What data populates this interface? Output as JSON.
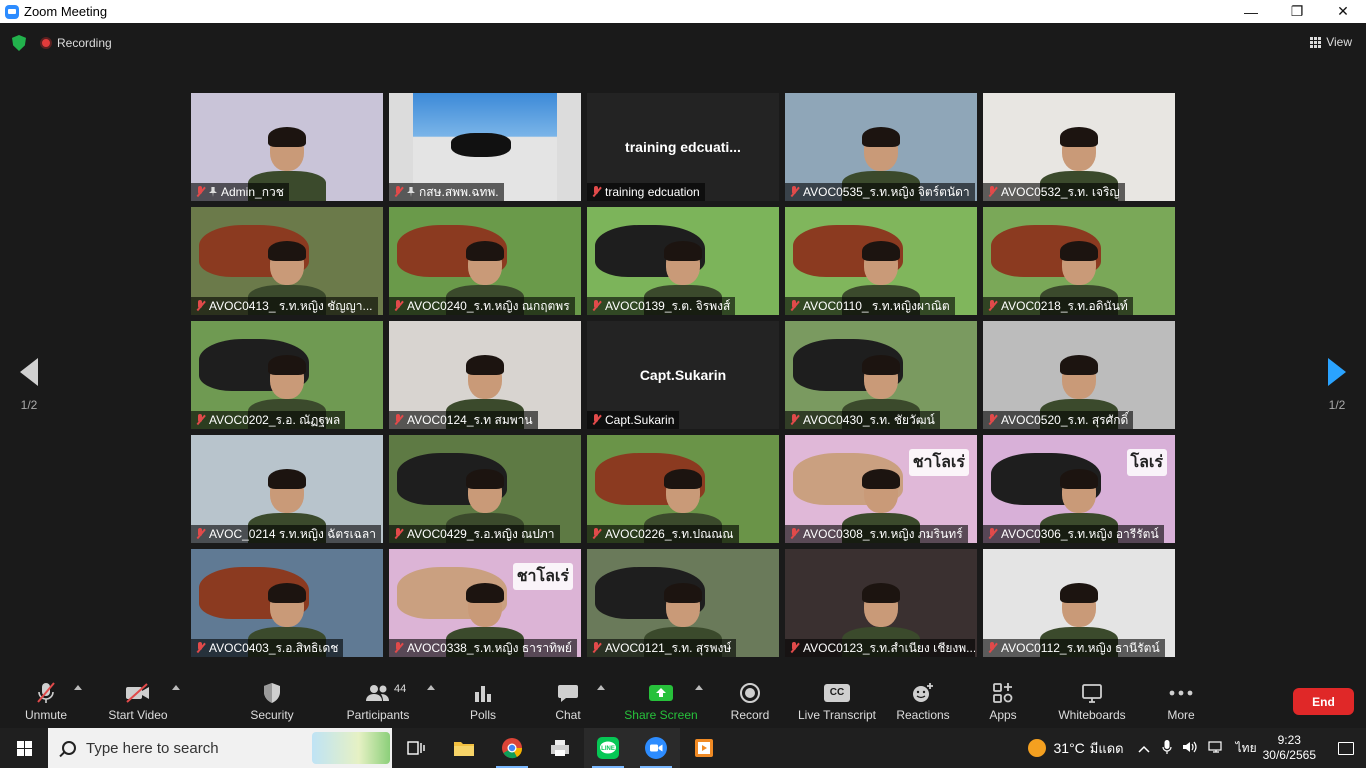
{
  "window": {
    "title": "Zoom Meeting",
    "minimize": "—",
    "restore": "❐",
    "close": "✕"
  },
  "meeting": {
    "recording_label": "Recording",
    "view_label": "View",
    "page_indicator_left": "1/2",
    "page_indicator_right": "1/2"
  },
  "participants": [
    {
      "name": "Admin_กวช",
      "bg": "#c9c4d8",
      "type": "admin"
    },
    {
      "name": "กสษ.สพพ.ฉทพ.",
      "bg": "#dcdcdc",
      "type": "photo"
    },
    {
      "name": "training edcuation",
      "bg": "#232323",
      "type": "nameonly",
      "display": "training  edcuati..."
    },
    {
      "name": "AVOC0535_ร.ท.หญิง จิตร์ตนัดา",
      "bg": "#8fa6b8",
      "type": "person"
    },
    {
      "name": "AVOC0532_ร.ท. เจริญ",
      "bg": "#e8e6e2",
      "type": "person"
    },
    {
      "name": "AVOC0413_ ร.ท.หญิง ชัญญา...",
      "bg": "#6b7a4a",
      "type": "cow"
    },
    {
      "name": "AVOC0240_ร.ท.หญิง ณกฤตพร",
      "bg": "#6a9a4a",
      "type": "cow"
    },
    {
      "name": "AVOC0139_ร.ต. จิรพงส์",
      "bg": "#7cb45a",
      "type": "cow"
    },
    {
      "name": "AVOC0110_ ร.ท.หญิงผาณิต",
      "bg": "#80b65c",
      "type": "cow"
    },
    {
      "name": "AVOC0218_ร.ท.อดินันท์",
      "bg": "#7aa858",
      "type": "cow"
    },
    {
      "name": "AVOC0202_ร.อ. ณัฏฐพล",
      "bg": "#6f9a52",
      "type": "cow"
    },
    {
      "name": "AVOC0124_ร.ท สมพาน",
      "bg": "#d8d4d0",
      "type": "person"
    },
    {
      "name": "Capt.Sukarin",
      "bg": "#232323",
      "type": "nameonly",
      "display": "Capt.Sukarin"
    },
    {
      "name": "AVOC0430_ร.ท. ชัยวัฒน์",
      "bg": "#7a9a60",
      "type": "cow"
    },
    {
      "name": "AVOC0520_ร.ท. สุรศักดิ์",
      "bg": "#bcbcbc",
      "type": "person"
    },
    {
      "name": "AVOC_0214 ร.ท.หญิง ฉัตรเฉลา",
      "bg": "#b8c4cc",
      "type": "person"
    },
    {
      "name": "AVOC0429_ร.อ.หญิง ณปภา",
      "bg": "#5e7a44",
      "type": "cow"
    },
    {
      "name": "AVOC0226_ร.ท.ปณณณ",
      "bg": "#6a9448",
      "type": "cow"
    },
    {
      "name": "AVOC0308_ร.ท.หญิง ภมรินทร์",
      "bg": "#e0b8d8",
      "type": "pinkcow",
      "banner": "ชาโลเร่"
    },
    {
      "name": "AVOC0306_ร.ท.หญิง อารีรัตน์",
      "bg": "#d8b0d8",
      "type": "pinkcow",
      "banner": "โลเร่"
    },
    {
      "name": "AVOC0403_ร.อ.สิทธิเดช",
      "bg": "#607a94",
      "type": "cow"
    },
    {
      "name": "AVOC0338_ร.ท.หญิง ธาราทิพย์",
      "bg": "#dcb4d6",
      "type": "pinkcow",
      "banner": "ชาโลเร่"
    },
    {
      "name": "AVOC0121_ร.ท. สุรพงษ์",
      "bg": "#6a7a5a",
      "type": "cow"
    },
    {
      "name": "AVOC0123_ร.ท.สำเนียง เชียงพ...",
      "bg": "#3a3030",
      "type": "person"
    },
    {
      "name": "AVOC0112_ร.ท.หญิง ธานีรัตน์",
      "bg": "#e4e4e4",
      "type": "person"
    }
  ],
  "toolbar": {
    "unmute": "Unmute",
    "start_video": "Start Video",
    "security": "Security",
    "participants": "Participants",
    "participants_count": "44",
    "polls": "Polls",
    "chat": "Chat",
    "share_screen": "Share Screen",
    "record": "Record",
    "live_transcript": "Live Transcript",
    "cc_icon_text": "CC",
    "reactions": "Reactions",
    "apps": "Apps",
    "whiteboards": "Whiteboards",
    "more": "More",
    "end": "End"
  },
  "taskbar": {
    "search_placeholder": "Type here to search",
    "weather": "31°C",
    "weather_desc": "มีแดด",
    "language": "ไทย",
    "time": "9:23",
    "date": "30/6/2565"
  },
  "colors": {
    "accent_green": "#27c13b",
    "end_red": "#e02828",
    "active_speaker": "#e8e05a",
    "next_arrow": "#2aa3ff"
  }
}
